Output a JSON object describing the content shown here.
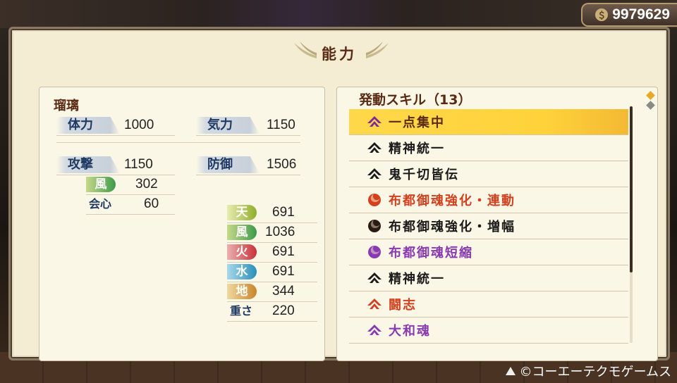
{
  "money": "9979629",
  "money_icon": "coin-icon",
  "title": "能力",
  "character": "瑠璃",
  "stats": {
    "stamina_label": "体力",
    "stamina": "1000",
    "ki_label": "気力",
    "ki": "1150",
    "attack_label": "攻撃",
    "attack": "1150",
    "defense_label": "防御",
    "defense": "1506",
    "attack_elem_label": "風",
    "attack_elem": "302",
    "crit_label": "会心",
    "crit": "60",
    "res": [
      {
        "label": "天",
        "value": "691",
        "color": "#8fae2a"
      },
      {
        "label": "風",
        "value": "1036",
        "color": "#3e9a4a"
      },
      {
        "label": "火",
        "value": "691",
        "color": "#c8323a"
      },
      {
        "label": "水",
        "value": "691",
        "color": "#2a8fb8"
      },
      {
        "label": "地",
        "value": "344",
        "color": "#c8862a"
      }
    ],
    "weight_label": "重さ",
    "weight": "220"
  },
  "skills_header": "発動スキル（13）",
  "skills": [
    {
      "label": "一点集中",
      "color": "#5a2a14",
      "icon": "yatagarasu-icon",
      "icon_color": "#7a2a9a"
    },
    {
      "label": "精神統一",
      "color": "#1a1a1a",
      "icon": "yatagarasu-icon",
      "icon_color": "#1a1a1a"
    },
    {
      "label": "鬼千切皆伝",
      "color": "#1a1a1a",
      "icon": "yatagarasu-icon",
      "icon_color": "#1a1a1a"
    },
    {
      "label": "布都御魂強化・連動",
      "color": "#d2401e",
      "icon": "tomoe-icon",
      "icon_color": "#d2401e"
    },
    {
      "label": "布都御魂強化・増幅",
      "color": "#1a1a1a",
      "icon": "tomoe-icon",
      "icon_color": "#2a1a14"
    },
    {
      "label": "布都御魂短縮",
      "color": "#8a3ab0",
      "icon": "tomoe-icon",
      "icon_color": "#8a3ab0"
    },
    {
      "label": "精神統一",
      "color": "#1a1a1a",
      "icon": "yatagarasu-icon",
      "icon_color": "#1a1a1a"
    },
    {
      "label": "闘志",
      "color": "#d2401e",
      "icon": "yatagarasu-icon",
      "icon_color": "#d2401e"
    },
    {
      "label": "大和魂",
      "color": "#8a3ab0",
      "icon": "yatagarasu-icon",
      "icon_color": "#8a3ab0"
    }
  ],
  "copyright": "©コーエーテクモゲームス"
}
